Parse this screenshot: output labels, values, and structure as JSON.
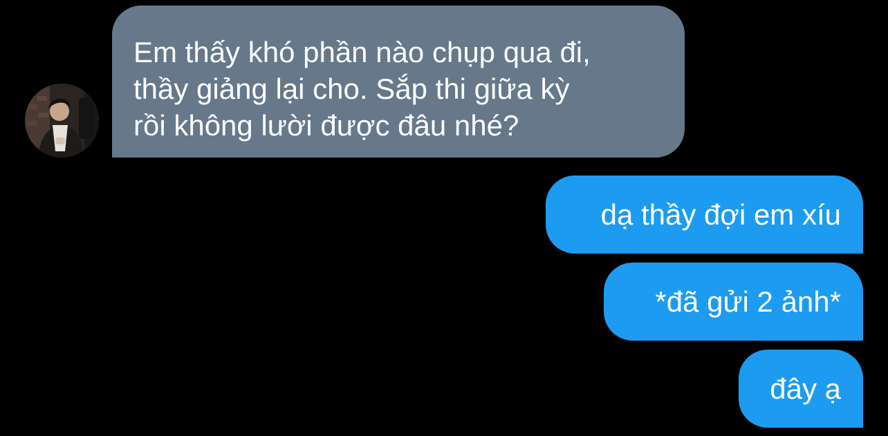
{
  "conversation": {
    "avatar_icon": "user-avatar-photo",
    "colors": {
      "background": "#000000",
      "incoming_bubble": "#66788a",
      "outgoing_bubble": "#1d9bf0",
      "text": "#ffffff"
    },
    "incoming": [
      {
        "text": "Em thấy khó phần nào chụp qua đi,\nthầy giảng lại cho. Sắp thi giữa kỳ\nrồi không lười được đâu nhé?"
      }
    ],
    "outgoing": [
      {
        "text": "dạ thầy đợi em xíu"
      },
      {
        "text": "*đã gửi 2 ảnh*"
      },
      {
        "text": "đây ạ"
      }
    ]
  }
}
